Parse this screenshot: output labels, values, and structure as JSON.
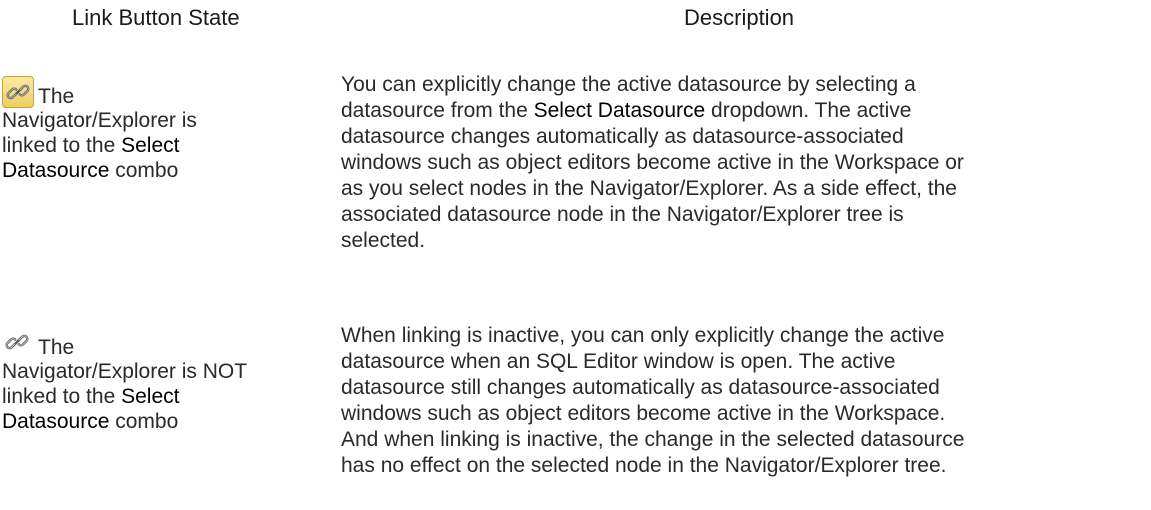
{
  "headers": {
    "state": "Link Button State",
    "description": "Description"
  },
  "rows": [
    {
      "icon": "chain-link-icon-active",
      "state": {
        "the": "The",
        "line2": "Navigator/Explorer is",
        "line3_pre": "linked to the ",
        "line3_bold": "Select",
        "line4_bold": "Datasource",
        "line4_post": " combo"
      },
      "description": {
        "l1": "You can explicitly change the active datasource by selecting a",
        "l2_pre": "datasource from the ",
        "l2_bold": "Select Datasource",
        "l2_post": " dropdown. The active",
        "l3": "datasource changes automatically as datasource-associated",
        "l4": "windows such as object editors become active in the Workspace or",
        "l5": "as you select nodes in the Navigator/Explorer. As a side effect, the",
        "l6": "associated datasource node in the Navigator/Explorer tree is",
        "l7": "selected."
      }
    },
    {
      "icon": "chain-link-icon-inactive",
      "state": {
        "the": "The",
        "line2": "Navigator/Explorer is NOT",
        "line3_pre": "linked to the ",
        "line3_bold": "Select",
        "line4_bold": "Datasource",
        "line4_post": " combo"
      },
      "description": {
        "l1": "When linking is inactive, you can only explicitly change the active",
        "l2": "datasource when an SQL Editor window is open. The active",
        "l3": "datasource still changes automatically as datasource-associated",
        "l4": "windows such as object editors become active in the Workspace.",
        "l5": "And when linking is inactive, the change in the selected datasource",
        "l6": "has no effect on the selected node in the Navigator/Explorer tree."
      }
    }
  ]
}
